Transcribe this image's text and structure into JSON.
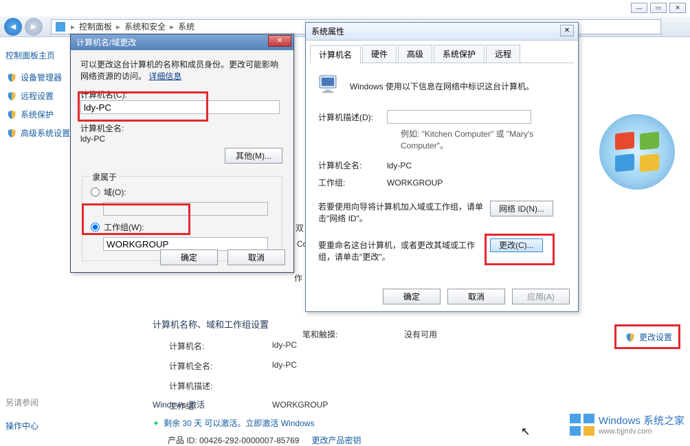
{
  "breadcrumb": {
    "p1": "控制面板",
    "p2": "系统和安全",
    "p3": "系统"
  },
  "leftbar": {
    "header": "控制面板主页",
    "items": [
      "设备管理器",
      "远程设置",
      "系统保护",
      "高级系统设置"
    ],
    "see_also": "另请参阅",
    "action_center": "操作中心"
  },
  "main": {
    "pentouch_label": "笔和触摸:",
    "pentouch_value": "没有可用",
    "section_name": "计算机名称、域和工作组设置",
    "computer_name_label": "计算机名:",
    "computer_name_value": "ldy-PC",
    "full_name_label": "计算机全名:",
    "full_name_value": "ldy-PC",
    "desc_label": "计算机描述:",
    "workgroup_label": "工作组:",
    "workgroup_value": "WORKGROUP",
    "change_settings": "更改设置",
    "activation_header": "Windows 激活",
    "activation_line": "剩余 30 天 可以激活。立即激活 Windows",
    "product_id_label": "产品 ID: 00426-292-0000007-85769",
    "change_key": "更改产品密钥"
  },
  "stray": {
    "zuo": "作",
    "co": "Co",
    "shuang": "双"
  },
  "sysprop": {
    "title": "系统属性",
    "tabs": [
      "计算机名",
      "硬件",
      "高级",
      "系统保护",
      "远程"
    ],
    "headline": "Windows 使用以下信息在网络中标识这台计算机。",
    "desc_label": "计算机描述(D):",
    "desc_hint": "例如: \"Kitchen Computer\" 或 \"Mary's Computer\"。",
    "full_label": "计算机全名:",
    "full_value": "ldy-PC",
    "wg_label": "工作组:",
    "wg_value": "WORKGROUP",
    "netid_text": "若要使用向导将计算机加入域或工作组，请单击\"网络 ID\"。",
    "netid_btn": "网络 ID(N)...",
    "change_text": "要重命名这台计算机，或者更改其域或工作组，请单击\"更改\"。",
    "change_btn": "更改(C)...",
    "ok": "确定",
    "cancel": "取消",
    "apply": "应用(A)"
  },
  "rename": {
    "title": "计算机名/域更改",
    "desc": "可以更改这台计算机的名称和成员身份。更改可能影响网络资源的访问。",
    "detail": "详细信息",
    "cn_label": "计算机名(C):",
    "cn_value": "ldy-PC",
    "full_label": "计算机全名:",
    "full_value": "ldy-PC",
    "other_btn": "其他(M)...",
    "member_of": "隶属于",
    "domain_label": "域(O):",
    "wg_label": "工作组(W):",
    "wg_value": "WORKGROUP",
    "ok": "确定",
    "cancel": "取消"
  },
  "watermark": {
    "line1": "Windows 系统之家",
    "line2": "www.bjjmlv.com"
  }
}
